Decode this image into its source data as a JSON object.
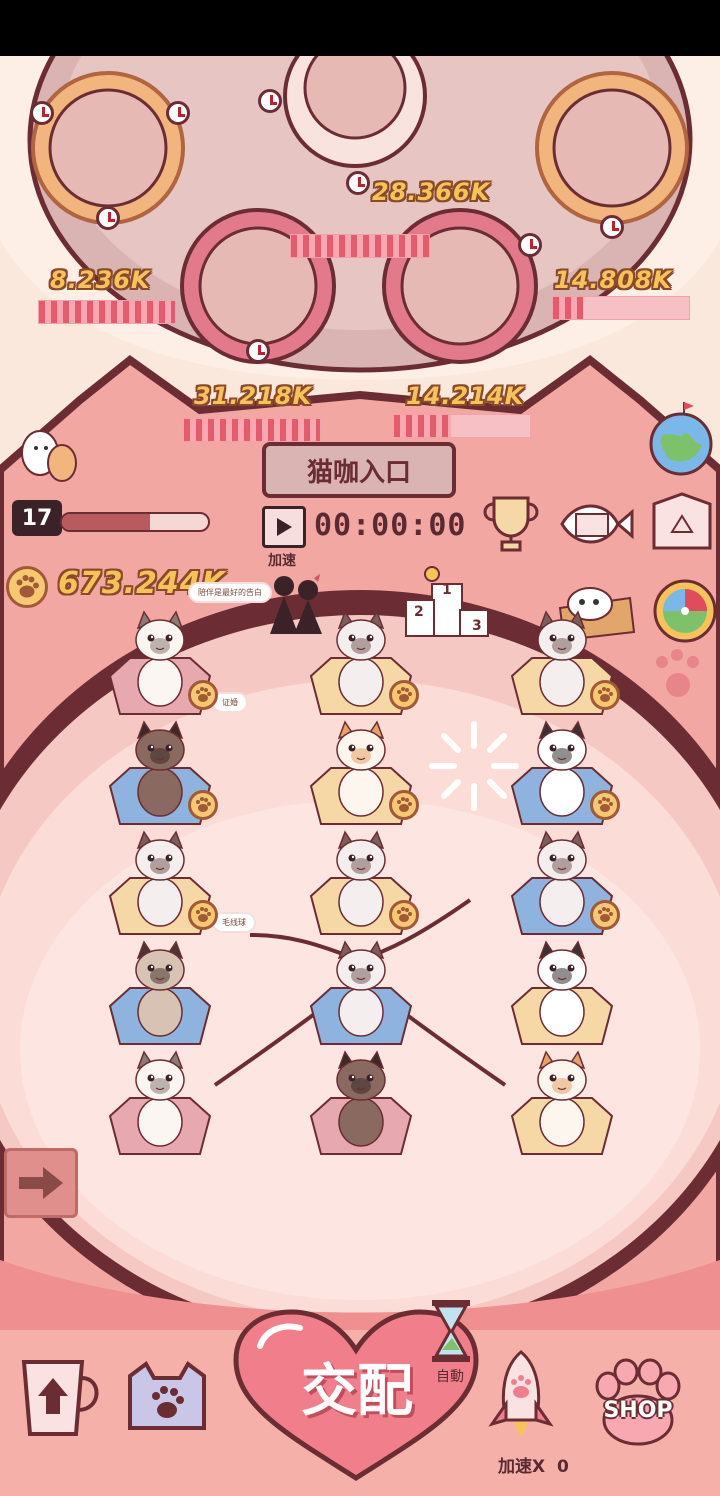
{
  "top_bar": {},
  "stations": [
    {
      "id": "left-pie",
      "income": "8.236K",
      "progress": 1.0
    },
    {
      "id": "center-top",
      "income": "28.366K",
      "progress": 1.0
    },
    {
      "id": "right-pie",
      "income": "14.808K",
      "progress": 0.22
    },
    {
      "id": "left-bottom",
      "income": "31.218K",
      "progress": 1.0
    },
    {
      "id": "right-bottom",
      "income": "14.214K",
      "progress": 0.42
    }
  ],
  "cafe_entrance": {
    "label": "猫咖入口"
  },
  "player": {
    "level": "17",
    "level_progress": 0.6,
    "coins": "673.244K"
  },
  "speed": {
    "timer": "00:00:00",
    "label": "加速"
  },
  "bubbles": {
    "b1": "陪伴是最好的告白",
    "b2": "证婚",
    "b3": "毛线球"
  },
  "podium": {
    "p1": "1",
    "p2": "2",
    "p3": "3"
  },
  "bottom": {
    "mate_label": "交配",
    "auto_label": "自動",
    "boost_label": "加速X",
    "boost_count": "0",
    "shop_label": "SHOP"
  },
  "colors": {
    "panel_pink": "#f2a7a3",
    "dark_outline": "#6b2d33",
    "coin": "#f6c35a",
    "seat_pink": "#e8a8b0",
    "seat_blue": "#8fb3df",
    "seat_cream": "#f6d7a6"
  },
  "cats": [
    {
      "row": 0,
      "col": 0,
      "breed": "ragdoll-white",
      "seat": "pink",
      "paw": true
    },
    {
      "row": 0,
      "col": 1,
      "breed": "siamese",
      "seat": "cream",
      "paw": true
    },
    {
      "row": 0,
      "col": 2,
      "breed": "siamese",
      "seat": "cream",
      "paw": true
    },
    {
      "row": 1,
      "col": 0,
      "breed": "siamese-dark",
      "seat": "blue",
      "paw": true
    },
    {
      "row": 1,
      "col": 1,
      "breed": "calico",
      "seat": "cream",
      "paw": true
    },
    {
      "row": 1,
      "col": 2,
      "breed": "black-white",
      "seat": "blue",
      "paw": true
    },
    {
      "row": 2,
      "col": 0,
      "breed": "siamese",
      "seat": "cream",
      "paw": true
    },
    {
      "row": 2,
      "col": 1,
      "breed": "siamese",
      "seat": "cream",
      "paw": true
    },
    {
      "row": 2,
      "col": 2,
      "breed": "siamese",
      "seat": "blue",
      "paw": true
    },
    {
      "row": 3,
      "col": 0,
      "breed": "ragdoll-dark",
      "seat": "blue",
      "paw": false
    },
    {
      "row": 3,
      "col": 1,
      "breed": "siamese",
      "seat": "blue",
      "paw": false
    },
    {
      "row": 3,
      "col": 2,
      "breed": "black-white",
      "seat": "cream",
      "paw": false
    },
    {
      "row": 4,
      "col": 0,
      "breed": "ragdoll-white",
      "seat": "pink",
      "paw": false
    },
    {
      "row": 4,
      "col": 1,
      "breed": "siamese-dark",
      "seat": "pink",
      "paw": false
    },
    {
      "row": 4,
      "col": 2,
      "breed": "calico",
      "seat": "cream",
      "paw": false
    }
  ],
  "icons": [
    "globe-icon",
    "trophy-icon",
    "calendar-fish-icon",
    "recycle-box-icon",
    "lucky-wheel-icon",
    "podium-icon",
    "play-icon",
    "arrow-right-icon",
    "cup-upgrade-icon",
    "cat-paw-tag-icon",
    "hourglass-icon",
    "rocket-icon",
    "shop-paw-icon",
    "paw-coin-icon"
  ]
}
